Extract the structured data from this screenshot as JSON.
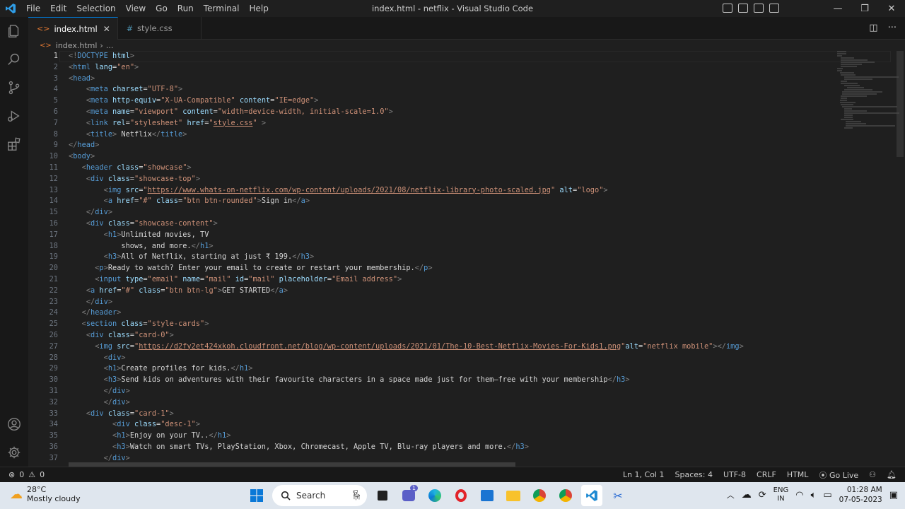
{
  "menu": [
    "File",
    "Edit",
    "Selection",
    "View",
    "Go",
    "Run",
    "Terminal",
    "Help"
  ],
  "window_title": "index.html - netflix - Visual Studio Code",
  "window_controls": {
    "minimize": "—",
    "maximize": "❐",
    "close": "✕"
  },
  "tabs": [
    {
      "label": "index.html",
      "icon": "<>",
      "close": "✕"
    },
    {
      "label": "style.css",
      "icon": "#"
    }
  ],
  "tab_actions": {
    "split": "◫",
    "more": "···"
  },
  "breadcrumb": {
    "file": "index.html",
    "sep": "›",
    "more": "..."
  },
  "code_lines": [
    {
      "n": "1",
      "html": "<span class=\"p\">&lt;!</span><span class=\"t\">DOCTYPE</span> <span class=\"a\">html</span><span class=\"p\">&gt;</span>"
    },
    {
      "n": "2",
      "html": "<span class=\"p\">&lt;</span><span class=\"t\">html</span> <span class=\"a\">lang</span><span class=\"x\">=</span><span class=\"s\">\"en\"</span><span class=\"p\">&gt;</span>"
    },
    {
      "n": "3",
      "html": "<span class=\"p\">&lt;</span><span class=\"t\">head</span><span class=\"p\">&gt;</span>"
    },
    {
      "n": "4",
      "html": "    <span class=\"p\">&lt;</span><span class=\"t\">meta</span> <span class=\"a\">charset</span><span class=\"x\">=</span><span class=\"s\">\"UTF-8\"</span><span class=\"p\">&gt;</span>"
    },
    {
      "n": "5",
      "html": "    <span class=\"p\">&lt;</span><span class=\"t\">meta</span> <span class=\"a\">http-equiv</span><span class=\"x\">=</span><span class=\"s\">\"X-UA-Compatible\"</span> <span class=\"a\">content</span><span class=\"x\">=</span><span class=\"s\">\"IE=edge\"</span><span class=\"p\">&gt;</span>"
    },
    {
      "n": "6",
      "html": "    <span class=\"p\">&lt;</span><span class=\"t\">meta</span> <span class=\"a\">name</span><span class=\"x\">=</span><span class=\"s\">\"viewport\"</span> <span class=\"a\">content</span><span class=\"x\">=</span><span class=\"s\">\"width=device-width, initial-scale=1.0\"</span><span class=\"p\">&gt;</span>"
    },
    {
      "n": "7",
      "html": "    <span class=\"p\">&lt;</span><span class=\"t\">link</span> <span class=\"a\">rel</span><span class=\"x\">=</span><span class=\"s\">\"stylesheet\"</span> <span class=\"a\">href</span><span class=\"x\">=</span><span class=\"s\">\"</span><span class=\"u\">style.css</span><span class=\"s\">\"</span> <span class=\"p\">&gt;</span>"
    },
    {
      "n": "8",
      "html": "    <span class=\"p\">&lt;</span><span class=\"t\">title</span><span class=\"p\">&gt;</span><span class=\"x\"> Netflix</span><span class=\"p\">&lt;/</span><span class=\"t\">title</span><span class=\"p\">&gt;</span>"
    },
    {
      "n": "9",
      "html": "<span class=\"p\">&lt;/</span><span class=\"t\">head</span><span class=\"p\">&gt;</span>"
    },
    {
      "n": "10",
      "html": "<span class=\"p\">&lt;</span><span class=\"t\">body</span><span class=\"p\">&gt;</span>"
    },
    {
      "n": "11",
      "html": "   <span class=\"p\">&lt;</span><span class=\"t\">header</span> <span class=\"a\">class</span><span class=\"x\">=</span><span class=\"s\">\"showcase\"</span><span class=\"p\">&gt;</span>"
    },
    {
      "n": "12",
      "html": "    <span class=\"p\">&lt;</span><span class=\"t\">div</span> <span class=\"a\">class</span><span class=\"x\">=</span><span class=\"s\">\"showcase-top\"</span><span class=\"p\">&gt;</span>"
    },
    {
      "n": "13",
      "html": "        <span class=\"p\">&lt;</span><span class=\"t\">img</span> <span class=\"a\">src</span><span class=\"x\">=</span><span class=\"s\">\"</span><span class=\"u\">https://www.whats-on-netflix.com/wp-content/uploads/2021/08/netflix-library-photo-scaled.jpg</span><span class=\"s\">\"</span> <span class=\"a\">alt</span><span class=\"x\">=</span><span class=\"s\">\"logo\"</span><span class=\"p\">&gt;</span>"
    },
    {
      "n": "14",
      "html": "        <span class=\"p\">&lt;</span><span class=\"t\">a</span> <span class=\"a\">href</span><span class=\"x\">=</span><span class=\"s\">\"#\"</span> <span class=\"a\">class</span><span class=\"x\">=</span><span class=\"s\">\"btn btn-rounded\"</span><span class=\"p\">&gt;</span><span class=\"x\">Sign in</span><span class=\"p\">&lt;/</span><span class=\"t\">a</span><span class=\"p\">&gt;</span>"
    },
    {
      "n": "15",
      "html": "    <span class=\"p\">&lt;/</span><span class=\"t\">div</span><span class=\"p\">&gt;</span>"
    },
    {
      "n": "16",
      "html": "    <span class=\"p\">&lt;</span><span class=\"t\">div</span> <span class=\"a\">class</span><span class=\"x\">=</span><span class=\"s\">\"showcase-content\"</span><span class=\"p\">&gt;</span>"
    },
    {
      "n": "17",
      "html": "        <span class=\"p\">&lt;</span><span class=\"t\">h1</span><span class=\"p\">&gt;</span><span class=\"x\">Unlimited movies, TV</span>"
    },
    {
      "n": "18",
      "html": "            <span class=\"x\">shows, and more.</span><span class=\"p\">&lt;/</span><span class=\"t\">h1</span><span class=\"p\">&gt;</span>"
    },
    {
      "n": "19",
      "html": "        <span class=\"p\">&lt;</span><span class=\"t\">h3</span><span class=\"p\">&gt;</span><span class=\"x\">All of Netflix, starting at just ₹ 199.</span><span class=\"p\">&lt;/</span><span class=\"t\">h3</span><span class=\"p\">&gt;</span>"
    },
    {
      "n": "20",
      "html": "      <span class=\"p\">&lt;</span><span class=\"t\">p</span><span class=\"p\">&gt;</span><span class=\"x\">Ready to watch? Enter your email to create or restart your membership.</span><span class=\"p\">&lt;/</span><span class=\"t\">p</span><span class=\"p\">&gt;</span>"
    },
    {
      "n": "21",
      "html": "      <span class=\"p\">&lt;</span><span class=\"t\">input</span> <span class=\"a\">type</span><span class=\"x\">=</span><span class=\"s\">\"email\"</span> <span class=\"a\">name</span><span class=\"x\">=</span><span class=\"s\">\"mail\"</span> <span class=\"a\">id</span><span class=\"x\">=</span><span class=\"s\">\"mail\"</span> <span class=\"a\">placeholder</span><span class=\"x\">=</span><span class=\"s\">\"Email address\"</span><span class=\"p\">&gt;</span>"
    },
    {
      "n": "22",
      "html": "    <span class=\"p\">&lt;</span><span class=\"t\">a</span> <span class=\"a\">href</span><span class=\"x\">=</span><span class=\"s\">\"#\"</span> <span class=\"a\">class</span><span class=\"x\">=</span><span class=\"s\">\"btn btn-lg\"</span><span class=\"p\">&gt;</span><span class=\"x\">GET STARTED</span><span class=\"p\">&lt;/</span><span class=\"t\">a</span><span class=\"p\">&gt;</span>"
    },
    {
      "n": "23",
      "html": "    <span class=\"p\">&lt;/</span><span class=\"t\">div</span><span class=\"p\">&gt;</span>"
    },
    {
      "n": "24",
      "html": "   <span class=\"p\">&lt;/</span><span class=\"t\">header</span><span class=\"p\">&gt;</span>"
    },
    {
      "n": "25",
      "html": "   <span class=\"p\">&lt;</span><span class=\"t\">section</span> <span class=\"a\">class</span><span class=\"x\">=</span><span class=\"s\">\"style-cards\"</span><span class=\"p\">&gt;</span>"
    },
    {
      "n": "26",
      "html": "    <span class=\"p\">&lt;</span><span class=\"t\">div</span> <span class=\"a\">class</span><span class=\"x\">=</span><span class=\"s\">\"card-0\"</span><span class=\"p\">&gt;</span>"
    },
    {
      "n": "27",
      "html": "      <span class=\"p\">&lt;</span><span class=\"t\">img</span> <span class=\"a\">src</span><span class=\"x\">=</span><span class=\"s\">\"</span><span class=\"u\">https://d2fy2et424xkoh.cloudfront.net/blog/wp-content/uploads/2021/01/The-10-Best-Netflix-Movies-For-Kids1.png</span><span class=\"s\">\"</span><span class=\"a\">alt</span><span class=\"x\">=</span><span class=\"s\">\"netflix mobile\"</span><span class=\"p\">&gt;&lt;/</span><span class=\"t\">img</span><span class=\"p\">&gt;</span>"
    },
    {
      "n": "28",
      "html": "        <span class=\"p\">&lt;</span><span class=\"t\">div</span><span class=\"p\">&gt;</span>"
    },
    {
      "n": "29",
      "html": "        <span class=\"p\">&lt;</span><span class=\"t\">h1</span><span class=\"p\">&gt;</span><span class=\"x\">Create profiles for kids.</span><span class=\"p\">&lt;/</span><span class=\"t\">h1</span><span class=\"p\">&gt;</span>"
    },
    {
      "n": "30",
      "html": "        <span class=\"p\">&lt;</span><span class=\"t\">h3</span><span class=\"p\">&gt;</span><span class=\"x\">Send kids on adventures with their favourite characters in a space made just for them—free with your membership</span><span class=\"p\">&lt;/</span><span class=\"t\">h3</span><span class=\"p\">&gt;</span>"
    },
    {
      "n": "31",
      "html": "        <span class=\"p\">&lt;/</span><span class=\"t\">div</span><span class=\"p\">&gt;</span>"
    },
    {
      "n": "32",
      "html": "        <span class=\"p\">&lt;/</span><span class=\"t\">div</span><span class=\"p\">&gt;</span>"
    },
    {
      "n": "33",
      "html": "    <span class=\"p\">&lt;</span><span class=\"t\">div</span> <span class=\"a\">class</span><span class=\"x\">=</span><span class=\"s\">\"card-1\"</span><span class=\"p\">&gt;</span>"
    },
    {
      "n": "34",
      "html": "          <span class=\"p\">&lt;</span><span class=\"t\">div</span> <span class=\"a\">class</span><span class=\"x\">=</span><span class=\"s\">\"desc-1\"</span><span class=\"p\">&gt;</span>"
    },
    {
      "n": "35",
      "html": "          <span class=\"p\">&lt;</span><span class=\"t\">h1</span><span class=\"p\">&gt;</span><span class=\"x\">Enjoy on your TV..</span><span class=\"p\">&lt;/</span><span class=\"t\">h1</span><span class=\"p\">&gt;</span>"
    },
    {
      "n": "36",
      "html": "          <span class=\"p\">&lt;</span><span class=\"t\">h3</span><span class=\"p\">&gt;</span><span class=\"x\">Watch on smart TVs, PlayStation, Xbox, Chromecast, Apple TV, Blu-ray players and more.</span><span class=\"p\">&lt;/</span><span class=\"t\">h3</span><span class=\"p\">&gt;</span>"
    },
    {
      "n": "37",
      "html": "        <span class=\"p\">&lt;/</span><span class=\"t\">div</span><span class=\"p\">&gt;</span>"
    }
  ],
  "status": {
    "errors": "0",
    "warnings": "0",
    "position": "Ln 1, Col 1",
    "spaces": "Spaces: 4",
    "encoding": "UTF-8",
    "eol": "CRLF",
    "language": "HTML",
    "golive": "Go Live"
  },
  "taskbar": {
    "temp": "28°C",
    "weather": "Mostly cloudy",
    "search": "Search",
    "lang1": "ENG",
    "lang2": "IN",
    "time": "01:28 AM",
    "date": "07-05-2023",
    "teams_badge": "1"
  },
  "colors": {
    "accent": "#0078d4",
    "tag": "#569cd6",
    "attr": "#9cdcfe",
    "string": "#ce9178"
  }
}
